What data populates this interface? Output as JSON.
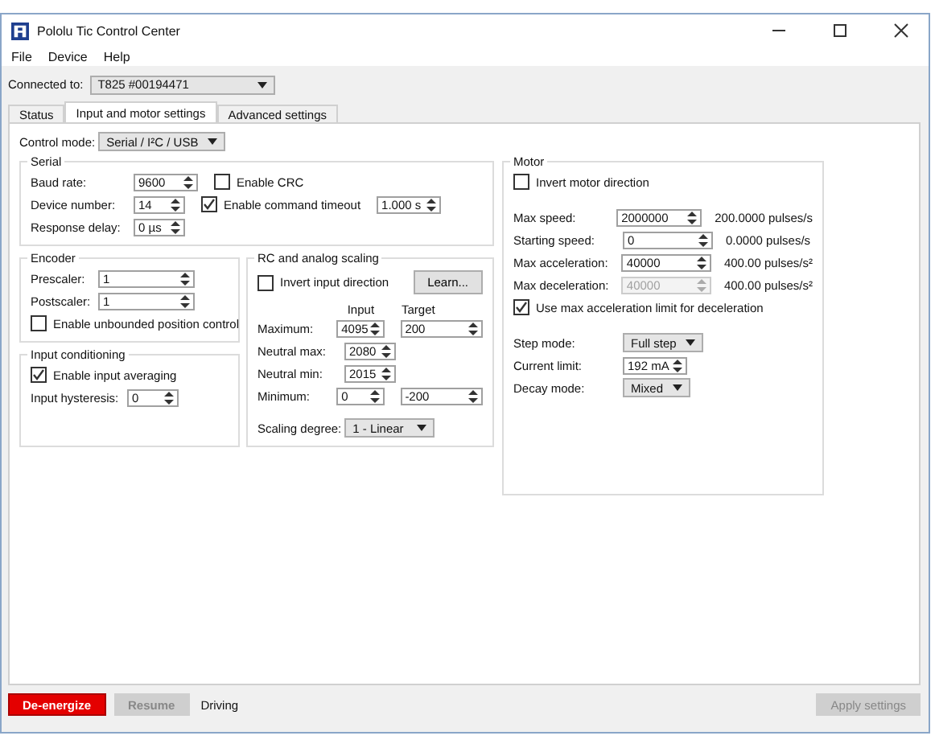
{
  "window": {
    "title": "Pololu Tic Control Center"
  },
  "menu": [
    {
      "label": "File"
    },
    {
      "label": "Device"
    },
    {
      "label": "Help"
    }
  ],
  "connection": {
    "label": "Connected to:",
    "value": "T825 #00194471"
  },
  "tabs": [
    {
      "label": "Status",
      "selected": false
    },
    {
      "label": "Input and motor settings",
      "selected": true
    },
    {
      "label": "Advanced settings",
      "selected": false
    }
  ],
  "control_mode": {
    "label": "Control mode:",
    "value": "Serial / I²C / USB"
  },
  "serial": {
    "title": "Serial",
    "rows": [
      {
        "label": "Baud rate:",
        "value": "9600",
        "check": {
          "label": "Enable CRC",
          "checked": false
        }
      },
      {
        "label": "Device number:",
        "value": "14",
        "check": {
          "label": "Enable command timeout",
          "checked": true,
          "value": "1.000 s"
        }
      },
      {
        "label": "Response delay:",
        "value": "0 µs"
      }
    ]
  },
  "encoder": {
    "title": "Encoder",
    "fields": [
      {
        "label": "Prescaler:",
        "value": "1"
      },
      {
        "label": "Postscaler:",
        "value": "1"
      }
    ],
    "check": {
      "label": "Enable unbounded position control",
      "checked": false
    }
  },
  "input_conditioning": {
    "title": "Input conditioning",
    "check": {
      "label": "Enable input averaging",
      "checked": true
    },
    "field": {
      "label": "Input hysteresis:",
      "value": "0"
    }
  },
  "rc_scaling": {
    "title": "RC and analog scaling",
    "check": {
      "label": "Invert input direction",
      "checked": false
    },
    "learn_button": "Learn...",
    "columns": [
      "Input",
      "Target"
    ],
    "rows": [
      {
        "label": "Maximum:",
        "input": "4095",
        "target": "200"
      },
      {
        "label": "Neutral max:",
        "input": "2080"
      },
      {
        "label": "Neutral min:",
        "input": "2015"
      },
      {
        "label": "Minimum:",
        "input": "0",
        "target": "-200"
      }
    ],
    "degree": {
      "label": "Scaling degree:",
      "value": "1 - Linear"
    }
  },
  "motor": {
    "title": "Motor",
    "check": {
      "label": "Invert motor direction",
      "checked": false
    },
    "speeds": [
      {
        "label": "Max speed:",
        "value": "2000000",
        "reading": "200.0000 pulses/s",
        "disabled": false
      },
      {
        "label": "Starting speed:",
        "value": "0",
        "reading": "0.0000 pulses/s",
        "disabled": false
      },
      {
        "label": "Max acceleration:",
        "value": "40000",
        "reading": "400.00 pulses/s²",
        "disabled": false
      },
      {
        "label": "Max deceleration:",
        "value": "40000",
        "reading": "400.00 pulses/s²",
        "disabled": true
      }
    ],
    "decel_check": {
      "label": "Use max acceleration limit for deceleration",
      "checked": true
    },
    "settings": [
      {
        "label": "Step mode:",
        "value": "Full step",
        "kind": "dropdown"
      },
      {
        "label": "Current limit:",
        "value": "192 mA",
        "kind": "spin"
      },
      {
        "label": "Decay mode:",
        "value": "Mixed",
        "kind": "dropdown"
      }
    ]
  },
  "bottom": {
    "buttons": [
      {
        "label": "De-energize",
        "kind": "danger",
        "disabled": false
      },
      {
        "label": "Resume",
        "kind": "normal",
        "disabled": true
      }
    ],
    "status": "Driving",
    "apply": {
      "label": "Apply settings",
      "disabled": true
    }
  }
}
